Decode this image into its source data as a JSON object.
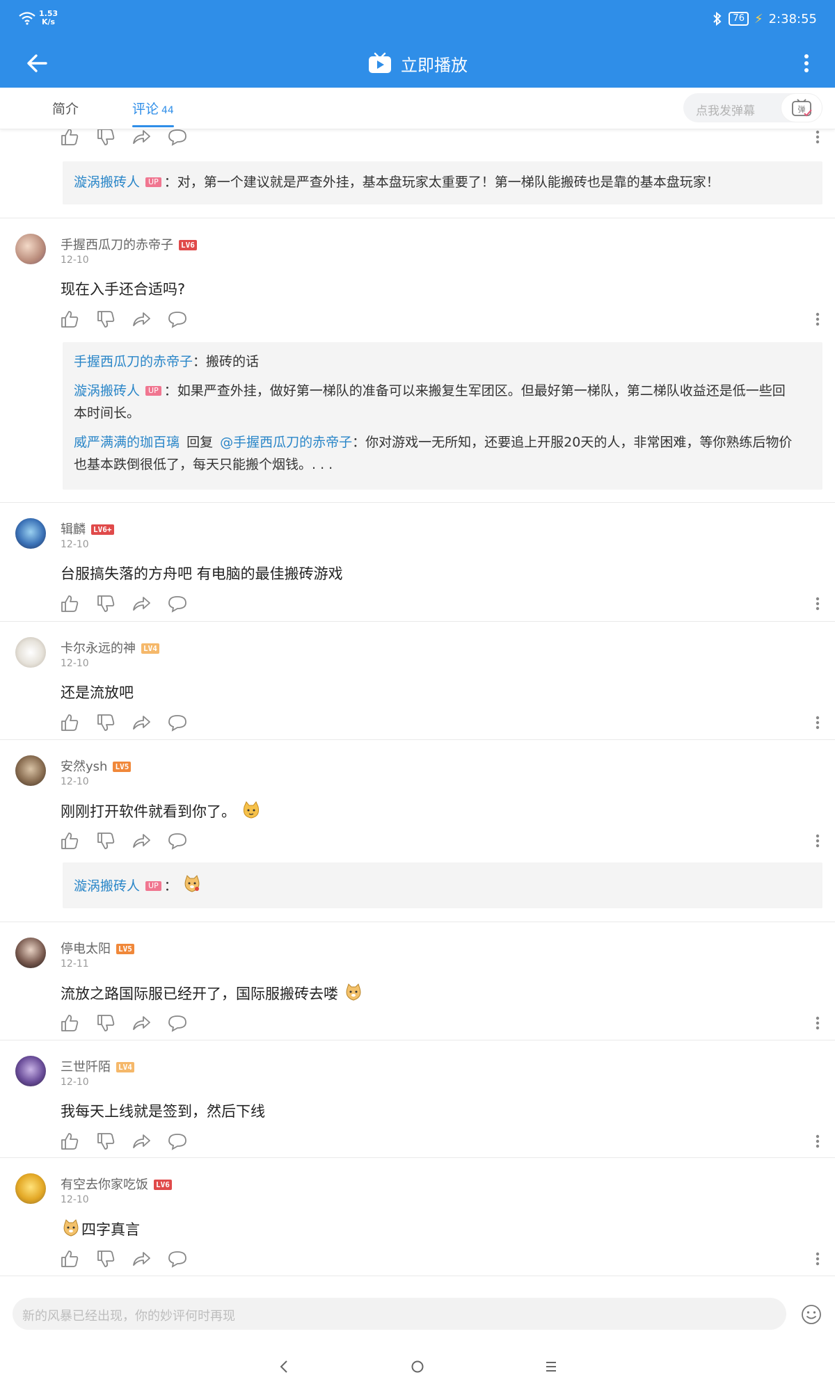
{
  "status": {
    "net_speed_value": "1.53",
    "net_speed_unit": "K/s",
    "battery": "76",
    "time": "2:38:55"
  },
  "header": {
    "title": "立即播放"
  },
  "tabs": {
    "intro": "简介",
    "comments": "评论",
    "comments_count": "44"
  },
  "danmaku": {
    "placeholder": "点我发弹幕",
    "button_label": "弹"
  },
  "top_reply": {
    "name": "漩涡搬砖人",
    "badge": "UP",
    "sep": "：",
    "text": "对，第一个建议就是严查外挂，基本盘玩家太重要了！第一梯队能搬砖也是靠的基本盘玩家！"
  },
  "comments": [
    {
      "user": "手握西瓜刀的赤帝子",
      "level": "LV6",
      "date": "12-10",
      "text": "现在入手还合适吗?",
      "replies": {
        "r1_name": "手握西瓜刀的赤帝子",
        "r1_sep": "：",
        "r1_text": "搬砖的话",
        "r2_name": "漩涡搬砖人",
        "r2_badge": "UP",
        "r2_sep": "：",
        "r2_text": "如果严查外挂，做好第一梯队的准备可以来搬复生军团区。但最好第一梯队，第二梯队收益还是低一些回本时间长。",
        "r3_name": "威严满满的珈百璃",
        "r3_reply_word": "回复",
        "r3_mention": "@手握西瓜刀的赤帝子",
        "r3_text": "：你对游戏一无所知，还要追上开服20天的人，非常困难，等你熟练后物价也基本跌倒很低了，每天只能搬个烟钱。. . ."
      }
    },
    {
      "user": "辑麟",
      "level": "LV6+",
      "date": "12-10",
      "text": "台服搞失落的方舟吧  有电脑的最佳搬砖游戏"
    },
    {
      "user": "卡尔永远的神",
      "level": "LV4",
      "date": "12-10",
      "text": "还是流放吧"
    },
    {
      "user": "安然ysh",
      "level": "LV5",
      "date": "12-10",
      "text": "刚刚打开软件就看到你了。",
      "reply_name": "漩涡搬砖人",
      "reply_badge": "UP",
      "reply_sep": "："
    },
    {
      "user": "停电太阳",
      "level": "LV5",
      "date": "12-11",
      "text": "流放之路国际服已经开了，国际服搬砖去喽"
    },
    {
      "user": "三世阡陌",
      "level": "LV4",
      "date": "12-10",
      "text": "我每天上线就是签到，然后下线"
    },
    {
      "user": "有空去你家吃饭",
      "level": "LV6",
      "date": "12-10",
      "text": "四字真言"
    }
  ],
  "input": {
    "placeholder": "新的风暴已经出现，你的妙评何时再现"
  },
  "colors": {
    "brand_blue": "#2f8ee8",
    "link_blue": "#2a86c8",
    "up_pink": "#f07690",
    "lv6_red": "#e04a4a",
    "lv5_orange": "#f0883a",
    "lv4_yellow": "#f5b86a"
  }
}
